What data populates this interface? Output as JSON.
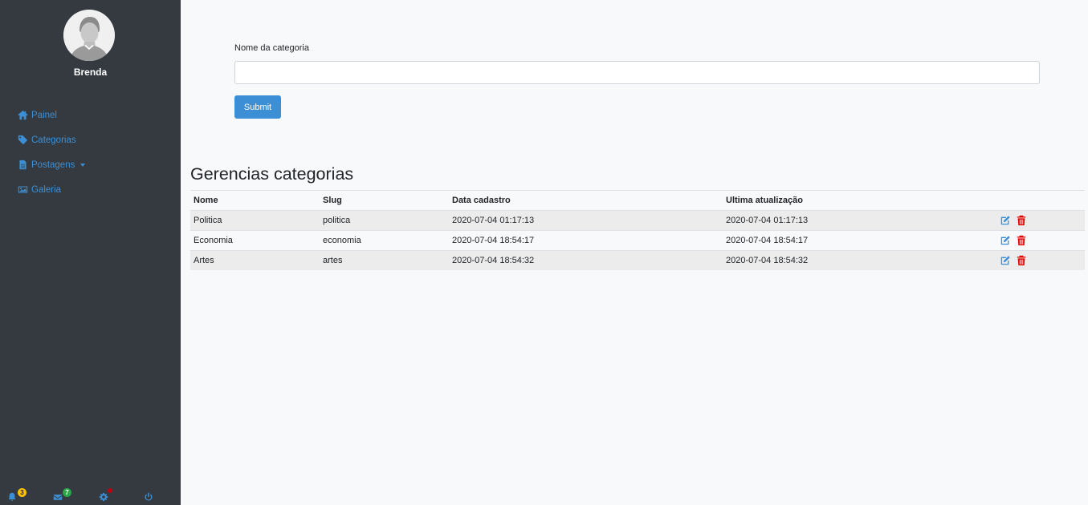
{
  "sidebar": {
    "username": "Brenda",
    "items": [
      {
        "label": "Painel",
        "icon": "home-icon"
      },
      {
        "label": "Categorias",
        "icon": "tag-icon"
      },
      {
        "label": "Postagens",
        "icon": "file-icon",
        "dropdown": true
      },
      {
        "label": "Galeria",
        "icon": "image-icon"
      }
    ],
    "bottom": {
      "notifications_count": "3",
      "messages_count": "7"
    }
  },
  "form": {
    "label": "Nome da categoria",
    "value": "",
    "submit_label": "Submit"
  },
  "table": {
    "title": "Gerencias categorias",
    "headers": [
      "Nome",
      "Slug",
      "Data cadastro",
      "Ultima atualização"
    ],
    "rows": [
      {
        "nome": "Politica",
        "slug": "politica",
        "data_cadastro": "2020-07-04 01:17:13",
        "ultima_atualizacao": "2020-07-04 01:17:13"
      },
      {
        "nome": "Economia",
        "slug": "economia",
        "data_cadastro": "2020-07-04 18:54:17",
        "ultima_atualizacao": "2020-07-04 18:54:17"
      },
      {
        "nome": "Artes",
        "slug": "artes",
        "data_cadastro": "2020-07-04 18:54:32",
        "ultima_atualizacao": "2020-07-04 18:54:32"
      }
    ]
  },
  "colors": {
    "sidebar_bg": "#343a40",
    "accent": "#3c8fd5",
    "delete": "#e00000",
    "badge_yellow": "#ffc107",
    "badge_green": "#28a745"
  }
}
